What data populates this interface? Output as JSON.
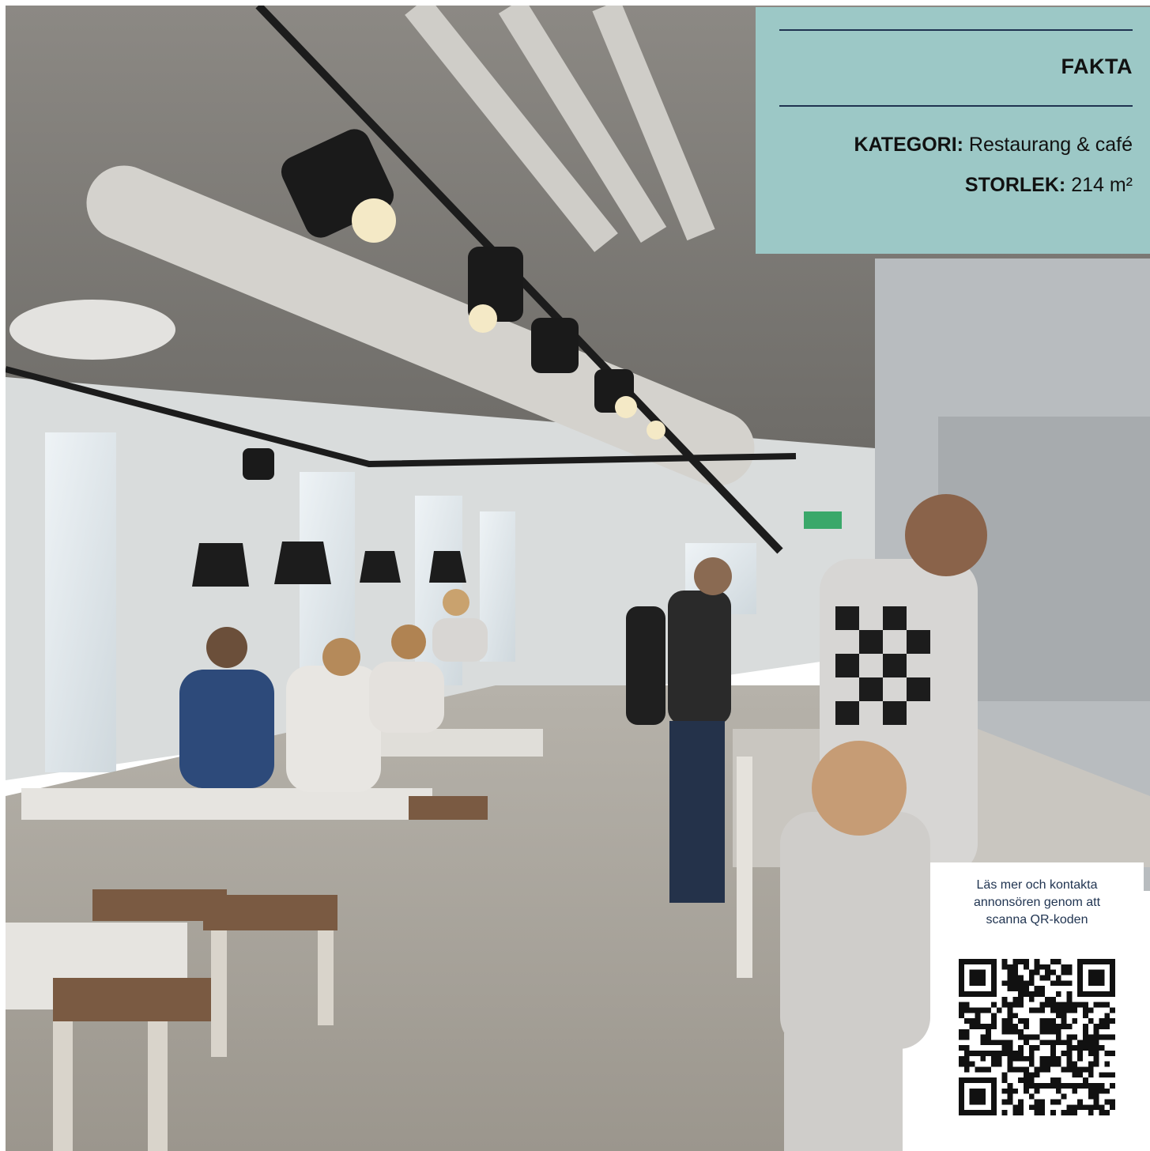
{
  "fakta": {
    "title": "FAKTA",
    "rows": [
      {
        "label": "KATEGORI:",
        "value": "Restaurang & café"
      },
      {
        "label": "STORLEK:",
        "value": "214 m²"
      }
    ],
    "panel_color": "#9cc8c6",
    "rule_color": "#1f3350"
  },
  "qr": {
    "text_lines": [
      "Läs mer och kontakta",
      "annonsören genom att",
      "scanna QR-koden"
    ],
    "icon": "qr-code-icon"
  }
}
